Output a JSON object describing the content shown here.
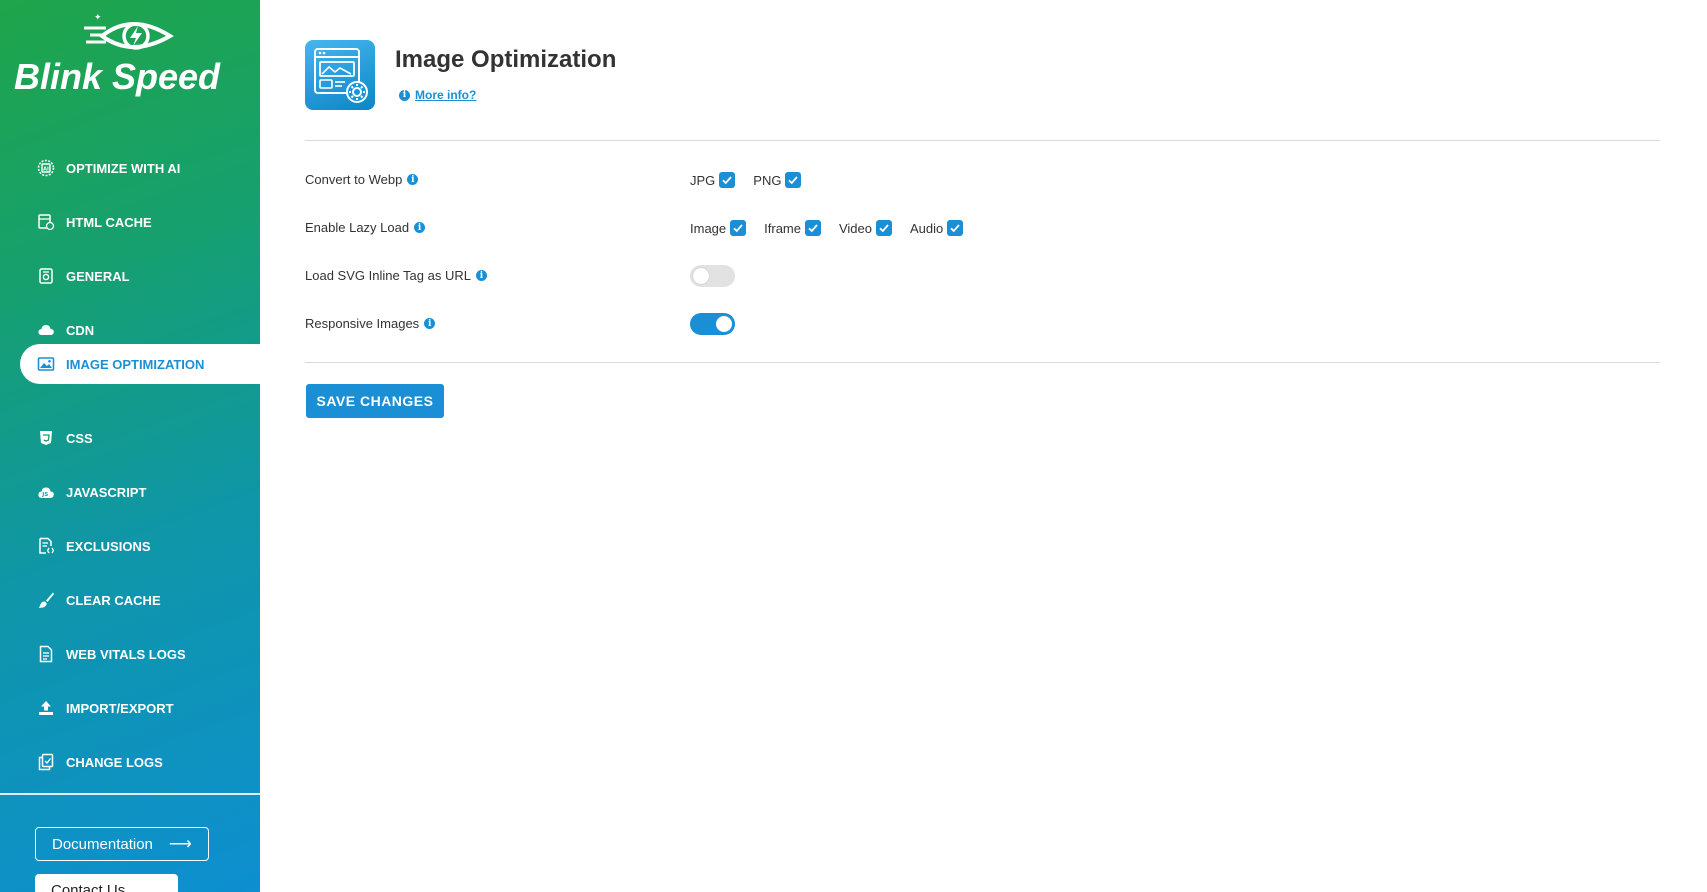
{
  "brand": {
    "name_left": "Blink",
    "name_right": "Speed"
  },
  "sidebar": {
    "items": [
      {
        "label": "OPTIMIZE WITH AI",
        "icon": "ai-chip-icon"
      },
      {
        "label": "HTML CACHE",
        "icon": "html-cache-icon"
      },
      {
        "label": "GENERAL",
        "icon": "general-settings-icon"
      },
      {
        "label": "CDN",
        "icon": "cloud-icon"
      },
      {
        "label": "IMAGE OPTIMIZATION",
        "icon": "image-icon",
        "active": true
      },
      {
        "label": "CSS",
        "icon": "css-icon"
      },
      {
        "label": "JAVASCRIPT",
        "icon": "javascript-cloud-icon"
      },
      {
        "label": "EXCLUSIONS",
        "icon": "exclusions-icon"
      },
      {
        "label": "CLEAR CACHE",
        "icon": "brush-icon"
      },
      {
        "label": "WEB VITALS LOGS",
        "icon": "document-icon"
      },
      {
        "label": "IMPORT/EXPORT",
        "icon": "upload-icon"
      },
      {
        "label": "CHANGE LOGS",
        "icon": "change-logs-icon"
      }
    ],
    "documentation_label": "Documentation",
    "contact_label": "Contact Us"
  },
  "header": {
    "title": "Image Optimization",
    "more_info": "More info?"
  },
  "settings": {
    "convert_webp": {
      "label": "Convert to Webp",
      "options": [
        {
          "label": "JPG",
          "checked": true
        },
        {
          "label": "PNG",
          "checked": true
        }
      ]
    },
    "lazy_load": {
      "label": "Enable Lazy Load",
      "options": [
        {
          "label": "Image",
          "checked": true
        },
        {
          "label": "Iframe",
          "checked": true
        },
        {
          "label": "Video",
          "checked": true
        },
        {
          "label": "Audio",
          "checked": true
        }
      ]
    },
    "svg_inline": {
      "label": "Load SVG Inline Tag as URL",
      "enabled": false
    },
    "responsive_images": {
      "label": "Responsive Images",
      "enabled": true
    }
  },
  "save_label": "SAVE CHANGES",
  "colors": {
    "accent": "#1b8fd6",
    "sidebar_top": "#1fa54a",
    "sidebar_bottom": "#0d8fd0"
  }
}
